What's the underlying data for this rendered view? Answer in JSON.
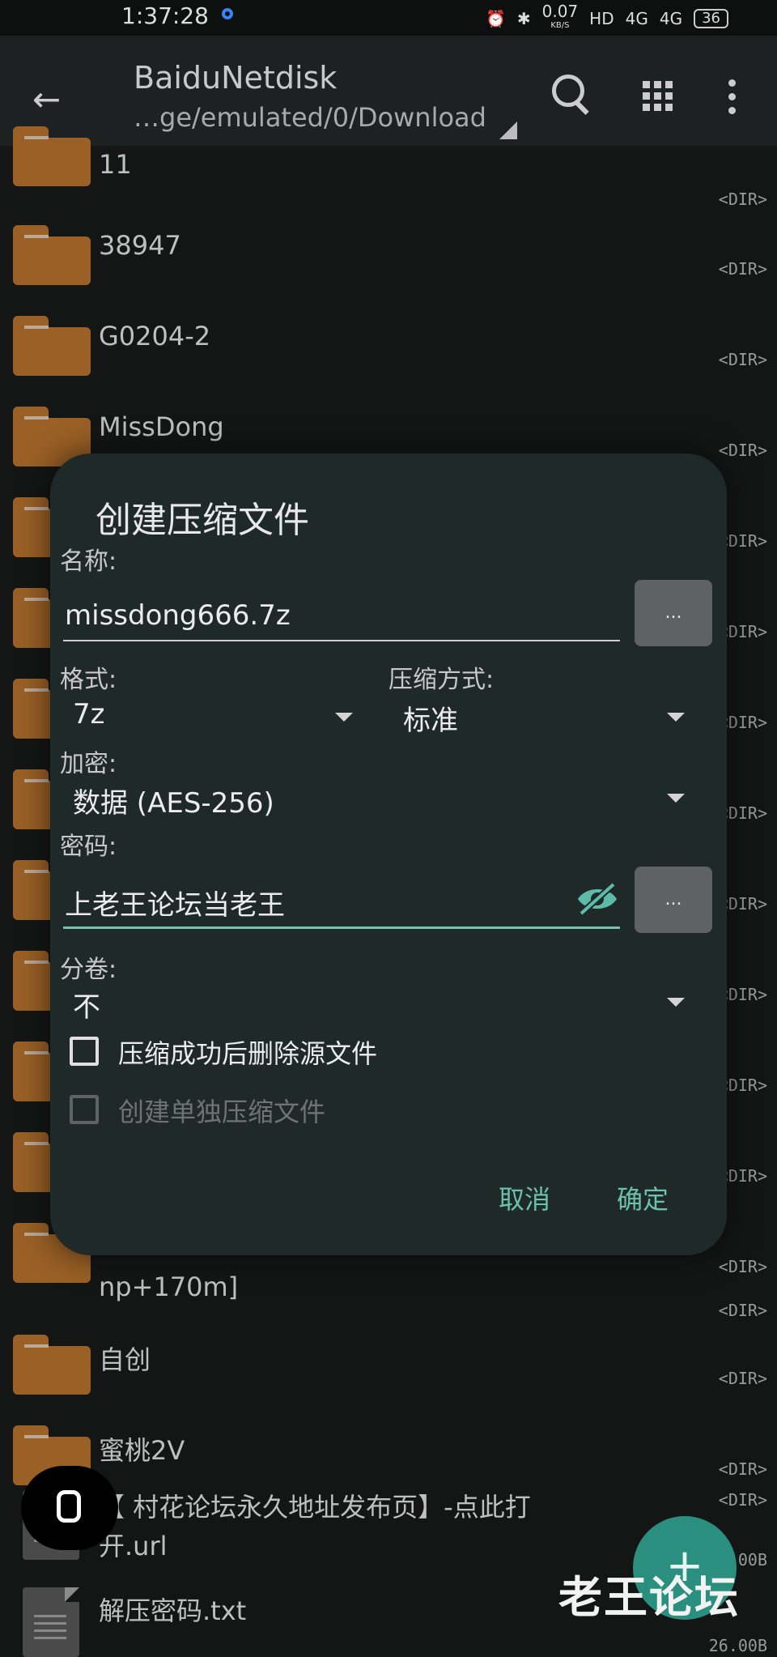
{
  "status_bar": {
    "time": "1:37:28",
    "net_speed": "0.07",
    "net_unit": "KB/S",
    "hd": "HD",
    "signal1": "4G",
    "signal2": "4G",
    "battery": "36"
  },
  "appbar": {
    "title": "BaiduNetdisk",
    "path": "…ge/emulated/0/Download"
  },
  "files": [
    {
      "name": "11",
      "info": "<DIR>"
    },
    {
      "name": "38947",
      "info": "<DIR>"
    },
    {
      "name": "G0204-2",
      "info": "<DIR>"
    },
    {
      "name": "MissDong",
      "info": "<DIR>"
    },
    {
      "name": "",
      "info": "<DIR>"
    },
    {
      "name": "",
      "info": "<DIR>"
    },
    {
      "name": "",
      "info": "<DIR>"
    },
    {
      "name": "",
      "info": "<DIR>"
    },
    {
      "name": "",
      "info": "<DIR>"
    },
    {
      "name": "",
      "info": "<DIR>"
    },
    {
      "name": "",
      "info": "<DIR>"
    },
    {
      "name": "",
      "info": "<DIR>"
    },
    {
      "name": "",
      "info": "<DIR>"
    },
    {
      "name": "np+170m]",
      "info": "<DIR>"
    },
    {
      "name": "自创",
      "info": "<DIR>"
    },
    {
      "name": "蜜桃2V",
      "info": "<DIR>"
    },
    {
      "name_line1": "【 村花论坛永久地址发布页】-点此打",
      "name_line2": "开.url",
      "info": "<DIR>",
      "size": "00B"
    },
    {
      "name": "解压密码.txt",
      "size": "26.00B"
    }
  ],
  "dialog": {
    "title": "创建压缩文件",
    "name_label": "名称:",
    "name_value": "missdong666.7z",
    "browse_label": "...",
    "format_label": "格式:",
    "format_value": "7z",
    "method_label": "压缩方式:",
    "method_value": "标准",
    "encryption_label": "加密:",
    "encryption_value": "数据 (AES-256)",
    "password_label": "密码:",
    "password_value": "上老王论坛当老王",
    "split_label": "分卷:",
    "split_value": "不",
    "delete_source_label": "压缩成功后删除源文件",
    "separate_archives_label": "创建单独压缩文件",
    "cancel_label": "取消",
    "ok_label": "确定"
  },
  "fab_label": "+",
  "watermark": "老王论坛",
  "colors": {
    "accent": "#6bc0b0",
    "fab": "#2a8f7e",
    "folder": "#9a6026",
    "dialog_bg": "#1f2a28"
  }
}
